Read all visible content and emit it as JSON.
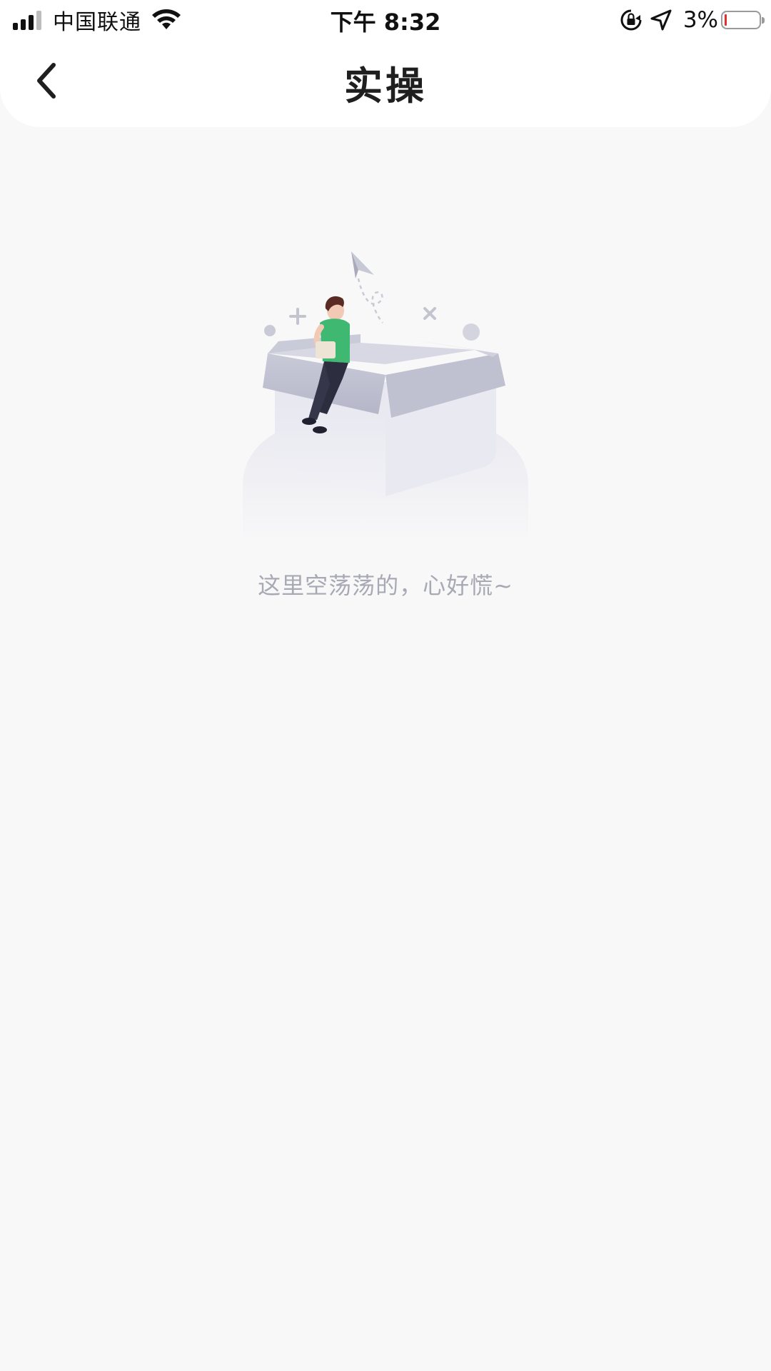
{
  "status_bar": {
    "carrier": "中国联通",
    "time": "下午 8:32",
    "battery_percent": "3%",
    "icons": [
      "signal-icon",
      "wifi-icon",
      "orientation-lock-icon",
      "location-arrow-icon",
      "battery-icon"
    ]
  },
  "nav": {
    "title": "实操",
    "back_icon": "chevron-left-icon"
  },
  "empty_state": {
    "illustration": "empty-box-with-person-illustration",
    "message": "这里空荡荡的，心好慌~"
  },
  "colors": {
    "background": "#f8f8f9",
    "header": "#ffffff",
    "title": "#1f1f1f",
    "empty_text": "#a8a9b4",
    "shirt_green": "#3fb872",
    "battery_low": "#e0312d"
  }
}
